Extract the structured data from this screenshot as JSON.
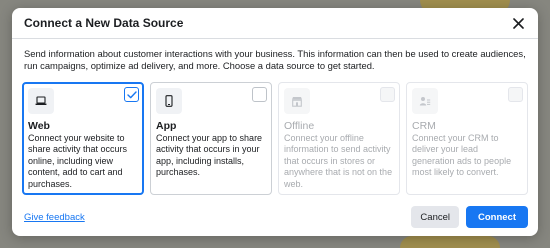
{
  "dialog": {
    "title": "Connect a New Data Source",
    "description": "Send information about customer interactions with your business. This information can then be used to create audiences, run campaigns, optimize ad delivery, and more. Choose a data source to get started."
  },
  "cards": [
    {
      "title": "Web",
      "text": "Connect your website to share activity that occurs online, including view content, add to cart and purchases.",
      "icon": "laptop-icon",
      "selected": true,
      "disabled": false
    },
    {
      "title": "App",
      "text": "Connect your app to share activity that occurs in your app, including installs, purchases.",
      "icon": "phone-icon",
      "selected": false,
      "disabled": false
    },
    {
      "title": "Offline",
      "text": "Connect your offline information to send activity that occurs in stores or anywhere that is not on the web.",
      "icon": "store-icon",
      "selected": false,
      "disabled": true
    },
    {
      "title": "CRM",
      "text": "Connect your CRM to deliver your lead generation ads to people most likely to convert.",
      "icon": "crm-icon",
      "selected": false,
      "disabled": true
    }
  ],
  "footer": {
    "feedback_label": "Give feedback",
    "cancel_label": "Cancel",
    "connect_label": "Connect"
  },
  "colors": {
    "accent": "#1877f2",
    "text": "#1c1e21",
    "disabled_text": "#a8abaf"
  }
}
